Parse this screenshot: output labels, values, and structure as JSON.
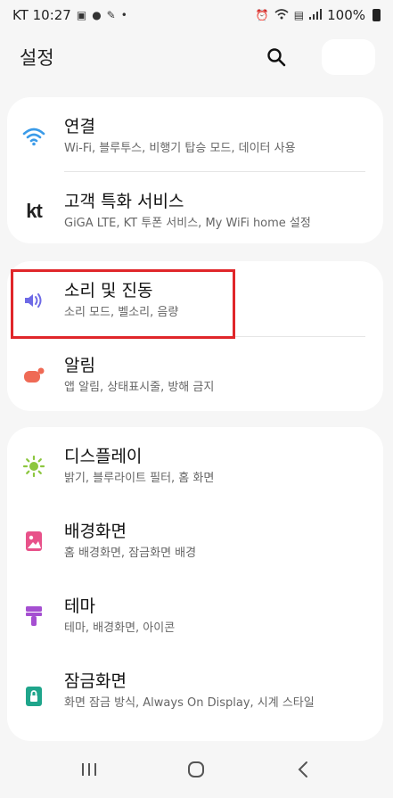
{
  "status_bar": {
    "carrier_time": "KT 10:27",
    "battery": "100%"
  },
  "header": {
    "title": "설정"
  },
  "groups": [
    {
      "items": [
        {
          "title": "연결",
          "subtitle": "Wi-Fi, 블루투스, 비행기 탑승 모드, 데이터 사용",
          "icon": "wifi-icon"
        },
        {
          "title": "고객 특화 서비스",
          "subtitle": "GiGA LTE, KT 투폰 서비스, My WiFi home 설정",
          "icon": "kt-logo-icon"
        }
      ]
    },
    {
      "items": [
        {
          "title": "소리 및 진동",
          "subtitle": "소리 모드, 벨소리, 음량",
          "icon": "speaker-icon"
        },
        {
          "title": "알림",
          "subtitle": "앱 알림, 상태표시줄, 방해 금지",
          "icon": "notification-icon"
        }
      ]
    },
    {
      "items": [
        {
          "title": "디스플레이",
          "subtitle": "밝기, 블루라이트 필터, 홈 화면",
          "icon": "brightness-icon"
        },
        {
          "title": "배경화면",
          "subtitle": "홈 배경화면, 잠금화면 배경",
          "icon": "wallpaper-icon"
        },
        {
          "title": "테마",
          "subtitle": "테마, 배경화면, 아이콘",
          "icon": "theme-brush-icon"
        },
        {
          "title": "잠금화면",
          "subtitle": "화면 잠금 방식, Always On Display, 시계 스타일",
          "icon": "lock-icon"
        }
      ]
    }
  ],
  "colors": {
    "wifi": "#3b9be8",
    "sound": "#6e6ae6",
    "notification": "#ef6a55",
    "display": "#8cc63f",
    "wallpaper": "#e8528a",
    "theme": "#a54fd1",
    "lock": "#1fa58b",
    "highlight": "#e0262a"
  }
}
